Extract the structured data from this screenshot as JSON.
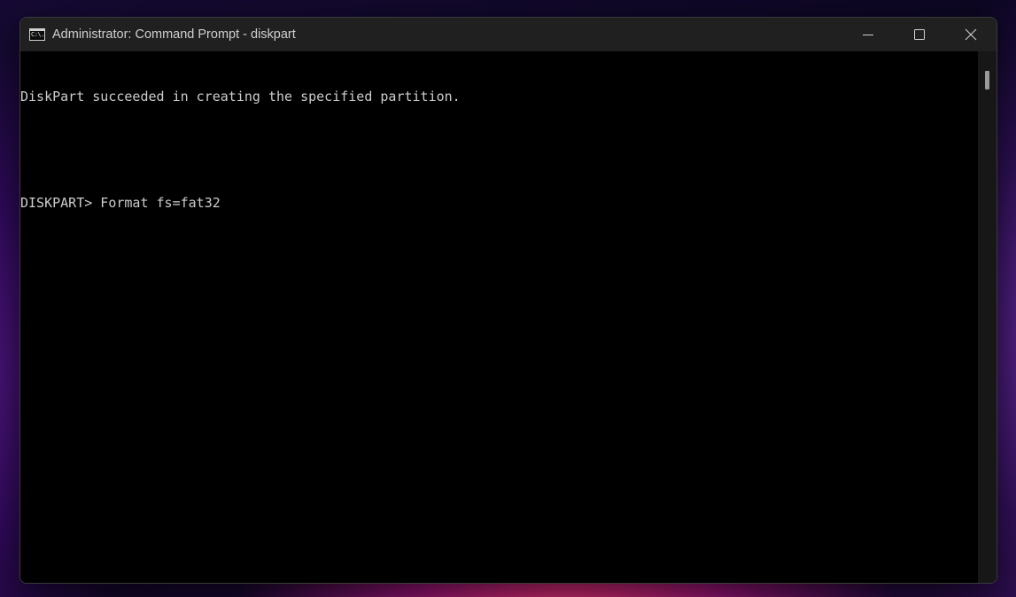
{
  "window": {
    "title": "Administrator: Command Prompt - diskpart",
    "icon": "cmd-icon",
    "icon_text": "C:\\."
  },
  "controls": {
    "minimize_icon": "minimize-icon",
    "maximize_icon": "maximize-icon",
    "close_icon": "close-icon"
  },
  "console": {
    "lines": [
      "DiskPart succeeded in creating the specified partition.",
      "",
      "DISKPART> Format fs=fat32"
    ]
  },
  "colors": {
    "console_bg": "#000000",
    "console_fg": "#cccccc",
    "titlebar_bg": "#202020"
  }
}
